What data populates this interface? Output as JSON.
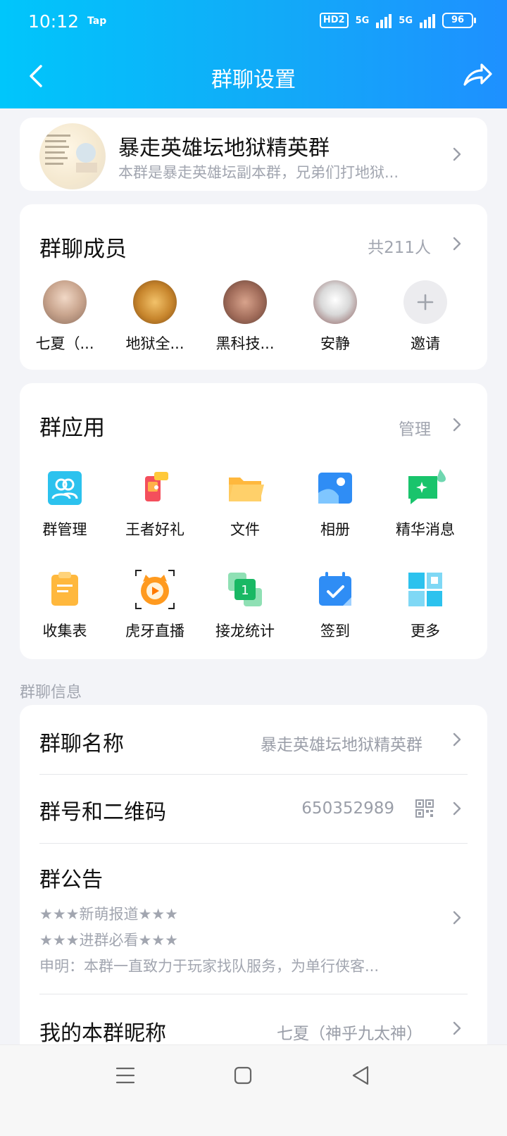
{
  "status_bar": {
    "time": "10:12",
    "carrier_badge": "Tap",
    "network": "5G",
    "hd": "HD2",
    "battery": "96"
  },
  "header": {
    "title": "群聊设置",
    "back_icon": "chevron-left-icon",
    "share_icon": "share-icon"
  },
  "group": {
    "name": "暴走英雄坛地狱精英群",
    "description": "本群是暴走英雄坛副本群，兄弟们打地狱..."
  },
  "members": {
    "title": "群聊成员",
    "count": "共211人",
    "list": [
      {
        "name": "七夏（..."
      },
      {
        "name": "地狱全..."
      },
      {
        "name": "黑科技..."
      },
      {
        "name": "安静"
      },
      {
        "name": "邀请"
      }
    ]
  },
  "apps": {
    "title": "群应用",
    "manage": "管理",
    "items": [
      {
        "label": "群管理",
        "icon": "group-manage-icon"
      },
      {
        "label": "王者好礼",
        "icon": "gift-icon"
      },
      {
        "label": "文件",
        "icon": "folder-icon"
      },
      {
        "label": "相册",
        "icon": "album-icon"
      },
      {
        "label": "精华消息",
        "icon": "essence-message-icon"
      },
      {
        "label": "收集表",
        "icon": "clipboard-icon"
      },
      {
        "label": "虎牙直播",
        "icon": "huya-live-icon"
      },
      {
        "label": "接龙统计",
        "icon": "relay-stat-icon"
      },
      {
        "label": "签到",
        "icon": "calendar-check-icon"
      },
      {
        "label": "更多",
        "icon": "grid-more-icon"
      }
    ]
  },
  "info": {
    "section_label": "群聊信息",
    "name_row": {
      "title": "群聊名称",
      "value": "暴走英雄坛地狱精英群"
    },
    "number_row": {
      "title": "群号和二维码",
      "value": "650352989"
    },
    "notice": {
      "title": "群公告",
      "lines": [
        "★★★新萌报道★★★",
        "★★★进群必看★★★",
        "申明：本群一直致力于玩家找队服务，为单行侠客..."
      ]
    },
    "nickname_row": {
      "title": "我的本群昵称",
      "value": "七夏（神乎九太神）"
    }
  },
  "colors": {
    "header_start": "#00c6fb",
    "header_end": "#1e90ff",
    "background": "#f3f4f8",
    "muted_text": "#a2a6b0"
  }
}
